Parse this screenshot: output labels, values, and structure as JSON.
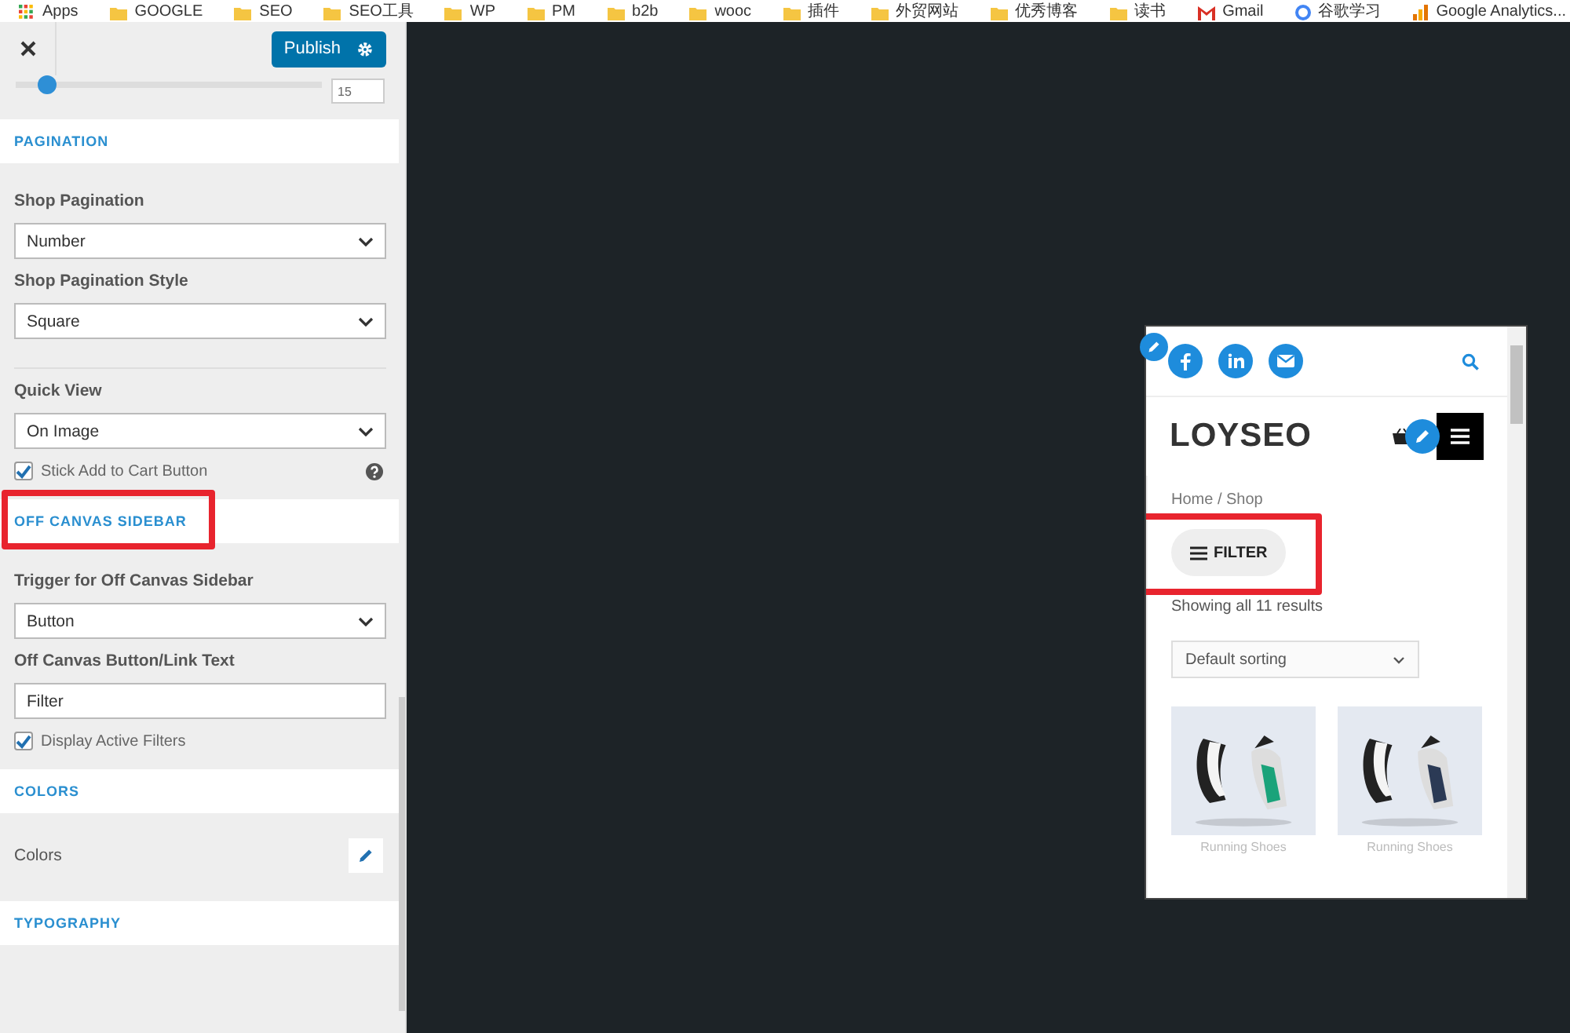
{
  "bookmarks": [
    {
      "label": "Apps",
      "kind": "apps"
    },
    {
      "label": "GOOGLE",
      "kind": "folder"
    },
    {
      "label": "SEO",
      "kind": "folder"
    },
    {
      "label": "SEO工具",
      "kind": "folder"
    },
    {
      "label": "WP",
      "kind": "folder"
    },
    {
      "label": "PM",
      "kind": "folder"
    },
    {
      "label": "b2b",
      "kind": "folder"
    },
    {
      "label": "wooc",
      "kind": "folder"
    },
    {
      "label": "插件",
      "kind": "folder"
    },
    {
      "label": "外贸网站",
      "kind": "folder"
    },
    {
      "label": "优秀博客",
      "kind": "folder"
    },
    {
      "label": "读书",
      "kind": "folder"
    },
    {
      "label": "Gmail",
      "kind": "gmail"
    },
    {
      "label": "谷歌学习",
      "kind": "google"
    },
    {
      "label": "Google Analytics...",
      "kind": "analytics"
    }
  ],
  "customizer": {
    "publish": "Publish",
    "slider": {
      "level": 0.1,
      "value": "15"
    },
    "items": [
      {
        "kind": "header",
        "title": "PAGINATION",
        "highlighted": false
      },
      {
        "kind": "select",
        "label": "Shop Pagination",
        "value": "Number"
      },
      {
        "kind": "select",
        "label": "Shop Pagination Style",
        "value": "Square"
      },
      {
        "kind": "divider"
      },
      {
        "kind": "select",
        "label": "Quick View",
        "value": "On Image"
      },
      {
        "kind": "checkbox",
        "label": "Stick Add to Cart Button",
        "checked": true,
        "help": true
      },
      {
        "kind": "header",
        "title": "OFF CANVAS SIDEBAR",
        "highlighted": true
      },
      {
        "kind": "select",
        "label": "Trigger for Off Canvas Sidebar",
        "value": "Button"
      },
      {
        "kind": "text",
        "label": "Off Canvas Button/Link Text",
        "value": "Filter"
      },
      {
        "kind": "checkbox",
        "label": "Display Active Filters",
        "checked": true,
        "help": false
      },
      {
        "kind": "header",
        "title": "COLORS",
        "highlighted": false
      },
      {
        "kind": "color",
        "label": "Colors"
      },
      {
        "kind": "header",
        "title": "TYPOGRAPHY",
        "highlighted": false
      }
    ]
  },
  "preview": {
    "socials": [
      {
        "kind": "facebook"
      },
      {
        "kind": "linkedin"
      },
      {
        "kind": "email"
      }
    ],
    "logo": "LOYSEO",
    "breadcrumb": "Home / Shop",
    "filter": {
      "label": "FILTER",
      "highlighted": true
    },
    "results": "Showing all 11 results",
    "sorting": "Default sorting",
    "products": [
      {
        "name": "Running Shoes"
      },
      {
        "name": "Running Shoes"
      }
    ]
  }
}
